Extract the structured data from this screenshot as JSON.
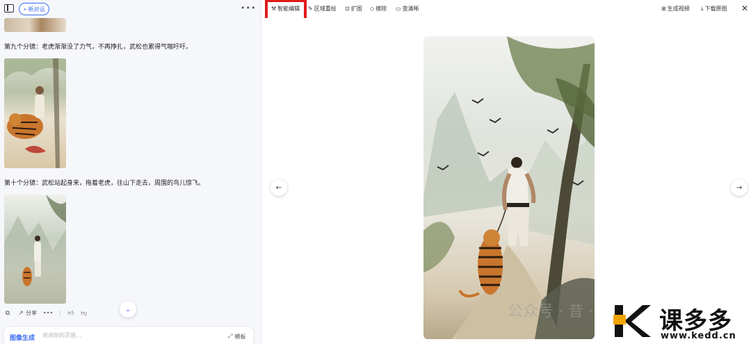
{
  "left_top": {
    "new_chat_label": "+ 新对话",
    "more_label": "•••"
  },
  "messages": [
    {
      "caption": "第九个分镜：老虎渐渐没了力气，不再挣扎，武松也累得气喘吁吁。"
    },
    {
      "caption": "第十个分镜：武松站起身来，拖着老虎，往山下走去，周围的鸟儿惊飞。"
    }
  ],
  "message_actions": {
    "share_label": "分享",
    "more_label": "•••"
  },
  "composer": {
    "mode_label": "图像生成",
    "placeholder": "说说你的灵感...",
    "template_label": "模板"
  },
  "toolbar": {
    "smart_edit": "智能编辑",
    "region_redraw": "区域重绘",
    "expand": "扩图",
    "erase": "擦除",
    "upscale": "变清晰",
    "generate_video": "生成视频",
    "download_original": "下载原图"
  },
  "watermark": {
    "text": "公众号 · 昔 ·",
    "brand_cn": "课多多",
    "brand_url": "www.kedd.cn"
  },
  "colors": {
    "accent": "#3b6df3",
    "highlight": "#e01b1b"
  },
  "icons": [
    "sidebar-toggle-icon",
    "plus-icon",
    "more-icon",
    "copy-icon",
    "share-icon",
    "thumbs-up-icon",
    "thumbs-down-icon",
    "chevron-down-icon",
    "template-icon",
    "magic-wand-icon",
    "brush-icon",
    "expand-icon",
    "eraser-icon",
    "hd-icon",
    "video-icon",
    "download-icon",
    "close-icon",
    "arrow-left-icon",
    "arrow-right-icon"
  ]
}
